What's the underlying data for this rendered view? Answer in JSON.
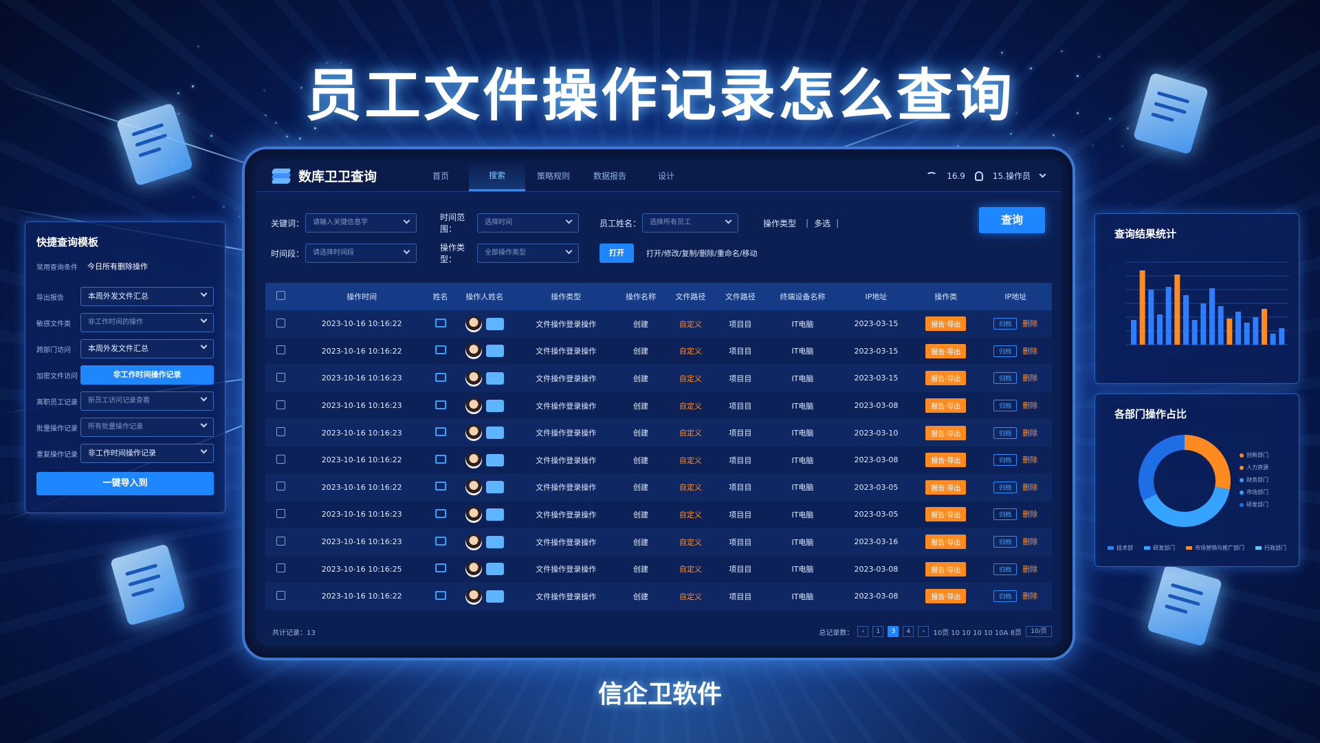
{
  "hero": {
    "title": "员工文件操作记录怎么查询",
    "brand": "信企卫软件"
  },
  "app": {
    "title": "数库卫卫查询",
    "tabs": [
      "首页",
      "搜索",
      "策略规则",
      "数据报告",
      "设计"
    ],
    "active_tab": 1,
    "status": {
      "signal": "16.9",
      "user": "15.操作员"
    }
  },
  "filters": {
    "keyword_label": "关键词：",
    "keyword_placeholder": "请输入关键信息字",
    "timerange_label": "时间范围：",
    "timerange_placeholder": "选择时间",
    "employee_label": "员工姓名：",
    "employee_placeholder": "选择所有员工",
    "optype_label": "操作类型",
    "optype_multi": "多选",
    "time_label": "时间段：",
    "time_placeholder": "请选择时间段",
    "optype2_label": "操作类型：",
    "optype2_placeholder": "全部操作类型",
    "open_button": "打开",
    "ops_text": "打开/修改/复制/删除/重命名/移动",
    "query_button": "查询"
  },
  "table": {
    "headers": [
      "操作时间",
      "姓名",
      "操作人姓名",
      "操作类型",
      "操作名称",
      "文件路径",
      "文件路径",
      "终端设备名称",
      "IP地址",
      "操作类",
      "IP地址"
    ],
    "rows": [
      {
        "time": "2023-10-16 10:16:22",
        "optype": "文件操作登录操作",
        "opname": "创建",
        "dir": "自定义",
        "path": "项目目",
        "device": "IT电脑",
        "ip": "2023-03-15",
        "op": "报告·导出",
        "ipb": "归档",
        "act": "删除"
      },
      {
        "time": "2023-10-16 10:16:22",
        "optype": "文件操作登录操作",
        "opname": "创建",
        "dir": "自定义",
        "path": "项目目",
        "device": "IT电脑",
        "ip": "2023-03-15",
        "op": "报告·导出",
        "ipb": "归档",
        "act": "删除"
      },
      {
        "time": "2023-10-16 10:16:23",
        "optype": "文件操作登录操作",
        "opname": "创建",
        "dir": "自定义",
        "path": "项目目",
        "device": "IT电脑",
        "ip": "2023-03-15",
        "op": "报告·导出",
        "ipb": "归档",
        "act": "删除"
      },
      {
        "time": "2023-10-16 10:16:23",
        "optype": "文件操作登录操作",
        "opname": "创建",
        "dir": "自定义",
        "path": "项目目",
        "device": "IT电脑",
        "ip": "2023-03-08",
        "op": "报告·导出",
        "ipb": "归档",
        "act": "删除"
      },
      {
        "time": "2023-10-16 10:16:23",
        "optype": "文件操作登录操作",
        "opname": "创建",
        "dir": "自定义",
        "path": "项目目",
        "device": "IT电脑",
        "ip": "2023-03-10",
        "op": "报告·导出",
        "ipb": "归档",
        "act": "删除"
      },
      {
        "time": "2023-10-16 10:16:22",
        "optype": "文件操作登录操作",
        "opname": "创建",
        "dir": "自定义",
        "path": "项目目",
        "device": "IT电脑",
        "ip": "2023-03-08",
        "op": "报告·导出",
        "ipb": "归档",
        "act": "删除"
      },
      {
        "time": "2023-10-16 10:16:22",
        "optype": "文件操作登录操作",
        "opname": "创建",
        "dir": "自定义",
        "path": "项目目",
        "device": "IT电脑",
        "ip": "2023-03-05",
        "op": "报告·导出",
        "ipb": "归档",
        "act": "删除"
      },
      {
        "time": "2023-10-16 10:16:23",
        "optype": "文件操作登录操作",
        "opname": "创建",
        "dir": "自定义",
        "path": "项目目",
        "device": "IT电脑",
        "ip": "2023-03-05",
        "op": "报告·导出",
        "ipb": "归档",
        "act": "删除"
      },
      {
        "time": "2023-10-16 10:16:23",
        "optype": "文件操作登录操作",
        "opname": "创建",
        "dir": "自定义",
        "path": "项目目",
        "device": "IT电脑",
        "ip": "2023-03-16",
        "op": "报告·导出",
        "ipb": "归档",
        "act": "删除"
      },
      {
        "time": "2023-10-16 10:16:25",
        "optype": "文件操作登录操作",
        "opname": "创建",
        "dir": "自定义",
        "path": "项目目",
        "device": "IT电脑",
        "ip": "2023-03-08",
        "op": "报告·导出",
        "ipb": "归档",
        "act": "删除"
      },
      {
        "time": "2023-10-16 10:16:22",
        "optype": "文件操作登录操作",
        "opname": "创建",
        "dir": "自定义",
        "path": "项目目",
        "device": "IT电脑",
        "ip": "2023-03-08",
        "op": "报告·导出",
        "ipb": "归档",
        "act": "删除"
      }
    ],
    "footer_left": "共计记录：13",
    "pager_label": "总记录数：",
    "pages": [
      "‹",
      "1",
      "3",
      "4",
      "›"
    ],
    "current_page": 3,
    "pager_tail": "10页  10  10  10  10  10A  8页",
    "pager_box": "10/页"
  },
  "quick": {
    "title": "快捷查询模板",
    "rows": [
      {
        "label": "常用查询条件",
        "value": "今日所有删除操作",
        "kind": "text"
      },
      {
        "label": "导出报告",
        "value": "本周外发文件汇总",
        "kind": "sel"
      },
      {
        "label": "敏感文件类",
        "value": "非工作时间的操作",
        "kind": "dim"
      },
      {
        "label": "跨部门访问",
        "value": "本周外发文件汇总",
        "kind": "sel"
      },
      {
        "label": "加密文件访问",
        "value": "非工作时间操作记录",
        "kind": "hi"
      },
      {
        "label": "离职员工记录",
        "value": "新员工访问记录查看",
        "kind": "dim"
      },
      {
        "label": "批量操作记录",
        "value": "所有批量操作记录",
        "kind": "dim"
      },
      {
        "label": "重复操作记录",
        "value": "非工作时间操作记录",
        "kind": "sel"
      }
    ],
    "button": "一键导入到"
  },
  "stats": {
    "title": "查询结果统计",
    "colors": {
      "orange": "#ff8a1f",
      "blue": "#2f7dff"
    },
    "bars": [
      {
        "o": 0,
        "b": 90
      },
      {
        "o": 270,
        "b": 0
      },
      {
        "o": 0,
        "b": 200
      },
      {
        "o": 0,
        "b": 110
      },
      {
        "o": 0,
        "b": 210
      },
      {
        "o": 255,
        "b": 0
      },
      {
        "o": 0,
        "b": 180
      },
      {
        "o": 0,
        "b": 90
      },
      {
        "o": 0,
        "b": 150
      },
      {
        "o": 0,
        "b": 205
      },
      {
        "o": 0,
        "b": 140
      },
      {
        "o": 95,
        "b": 0
      },
      {
        "o": 0,
        "b": 120
      },
      {
        "o": 0,
        "b": 80
      },
      {
        "o": 0,
        "b": 100
      },
      {
        "o": 130,
        "b": 0
      },
      {
        "o": 0,
        "b": 40
      },
      {
        "o": 0,
        "b": 60
      }
    ]
  },
  "dept": {
    "title": "各部门操作占比",
    "slices": [
      {
        "value": 28,
        "color": "#ff8a1f"
      },
      {
        "value": 40,
        "color": "#36a3ff"
      },
      {
        "value": 32,
        "color": "#1e6fe6"
      }
    ],
    "legend_right": [
      "创新部门",
      "人力资源",
      "财务部门",
      "市场部门",
      "研发部门"
    ],
    "legend_colors": [
      "#ff8a1f",
      "#ff8a1f",
      "#36a3ff",
      "#36a3ff",
      "#1e6fe6"
    ],
    "legend_bottom": [
      "技术部",
      "研发部门",
      "市场营销与推广部门",
      "行政部门"
    ],
    "legend_bottom_colors": [
      "#1e86ff",
      "#36a3ff",
      "#ff8a1f",
      "#5ec8ff"
    ]
  }
}
